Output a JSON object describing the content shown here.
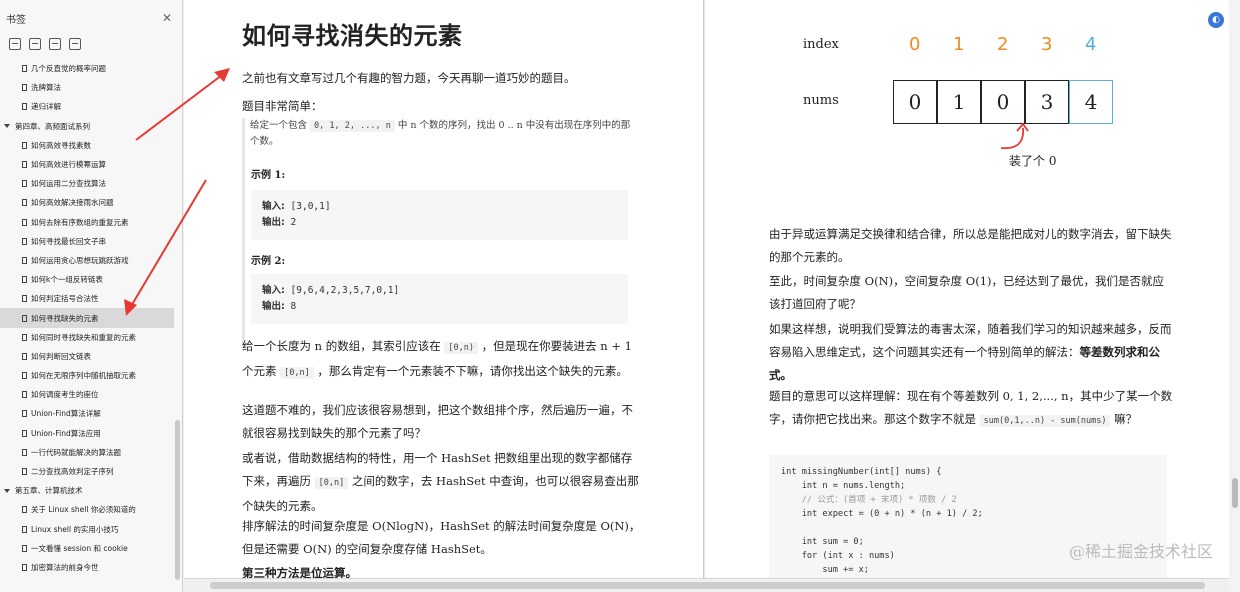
{
  "sidebar": {
    "title": "书签",
    "close_icon": "✕",
    "items": [
      {
        "label": "几个反直觉的概率问题",
        "level": 1
      },
      {
        "label": "洗牌算法",
        "level": 1
      },
      {
        "label": "递归详解",
        "level": 1
      },
      {
        "label": "第四章、高频面试系列",
        "level": 0
      },
      {
        "label": "如何高效寻找素数",
        "level": 1
      },
      {
        "label": "如何高效进行模幂运算",
        "level": 1
      },
      {
        "label": "如何运用二分查找算法",
        "level": 1
      },
      {
        "label": "如何高效解决接雨水问题",
        "level": 1
      },
      {
        "label": "如何去除有序数组的重复元素",
        "level": 1
      },
      {
        "label": "如何寻找最长回文子串",
        "level": 1
      },
      {
        "label": "如何运用贪心思想玩跳跃游戏",
        "level": 1
      },
      {
        "label": "如何k个一组反转链表",
        "level": 1
      },
      {
        "label": "如何判定括号合法性",
        "level": 1
      },
      {
        "label": "如何寻找缺失的元素",
        "level": 1,
        "active": true
      },
      {
        "label": "如何同时寻找缺失和重复的元素",
        "level": 1
      },
      {
        "label": "如何判断回文链表",
        "level": 1
      },
      {
        "label": "如何在无限序列中随机抽取元素",
        "level": 1
      },
      {
        "label": "如何调度考生的座位",
        "level": 1
      },
      {
        "label": "Union-Find算法详解",
        "level": 1
      },
      {
        "label": "Union-Find算法应用",
        "level": 1
      },
      {
        "label": "一行代码就能解决的算法题",
        "level": 1
      },
      {
        "label": "二分查找高效判定子序列",
        "level": 1
      },
      {
        "label": "第五章、计算机技术",
        "level": 0
      },
      {
        "label": "关于 Linux shell 你必须知道的",
        "level": 1
      },
      {
        "label": "Linux shell 的实用小技巧",
        "level": 1
      },
      {
        "label": "一文看懂 session 和 cookie",
        "level": 1
      },
      {
        "label": "加密算法的前身今世",
        "level": 1
      }
    ]
  },
  "left_page": {
    "title": "如何寻找消失的元素",
    "intro": "之前也有文章写过几个有趣的智力题，今天再聊一道巧妙的题目。",
    "simple": "题目非常简单：",
    "quote_1": "给定一个包含",
    "quote_seq": "0, 1, 2, ..., n",
    "quote_2": "中 n 个数的序列，找出 0 .. n 中没有出现在序列中的那个数。",
    "ex1_title": "示例 1:",
    "ex1_in_label": "输入:",
    "ex1_in": "[3,0,1]",
    "ex1_out_label": "输出:",
    "ex1_out": "2",
    "ex2_title": "示例 2:",
    "ex2_in_label": "输入:",
    "ex2_in": "[9,6,4,2,3,5,7,0,1]",
    "ex2_out_label": "输出:",
    "ex2_out": "8",
    "p1_a": "给一个长度为 n 的数组，其索引应该在",
    "p1_code1": "[0,n)",
    "p1_b": "，但是现在你要装进去 n + 1 个元素",
    "p1_code2": "[0,n]",
    "p1_c": "，那么肯定有一个元素装不下嘛，请你找出这个缺失的元素。",
    "p2": "这道题不难的，我们应该很容易想到，把这个数组排个序，然后遍历一遍，不就很容易找到缺失的那个元素了吗？",
    "p3_a": "或者说，借助数据结构的特性，用一个 HashSet 把数组里出现的数字都储存下来，再遍历",
    "p3_code": "[0,n]",
    "p3_b": "之间的数字，去 HashSet 中查询，也可以很容易查出那个缺失的元素。",
    "p4": "排序解法的时间复杂度是 O(NlogN)，HashSet 的解法时间复杂度是 O(N)，但是还需要 O(N) 的空间复杂度存储 HashSet。",
    "p5": "第三种方法是位运算。"
  },
  "right_page": {
    "figure": {
      "index_label": "index",
      "nums_label": "nums",
      "indices": [
        "0",
        "1",
        "2",
        "3",
        "4"
      ],
      "nums": [
        "0",
        "1",
        "0",
        "3",
        "4"
      ],
      "note": "装了个 0",
      "index_color": "#f08a24",
      "last_index_color": "#4fb0d8"
    },
    "p1": "由于异或运算满足交换律和结合律，所以总是能把成对儿的数字消去，留下缺失的那个元素的。",
    "p2": "至此，时间复杂度 O(N)，空间复杂度 O(1)，已经达到了最优，我们是否就应该打道回府了呢？",
    "p3_a": "如果这样想，说明我们受算法的毒害太深，随着我们学习的知识越来越多，反而容易陷入思维定式，这个问题其实还有一个特别简单的解法：",
    "p3_b": "等差数列求和公式。",
    "p4_a": "题目的意思可以这样理解：现在有个等差数列 0, 1, 2,..., n，其中少了某一个数字，请你把它找出来。那这个数字不就是",
    "p4_code": "sum(0,1,..n) - sum(nums)",
    "p4_b": "嘛？",
    "code_lines": [
      "int missingNumber(int[] nums) {",
      "    int n = nums.length;",
      "    // 公式：(首项 + 末项) * 项数 / 2",
      "    int expect = (0 + n) * (n + 1) / 2;",
      "",
      "    int sum = 0;",
      "    for (int x : nums)",
      "        sum += x;"
    ],
    "watermark": "@稀土掘金技术社区"
  },
  "colors": {
    "arrow": "#e53935",
    "fab": "#3a76d8"
  }
}
